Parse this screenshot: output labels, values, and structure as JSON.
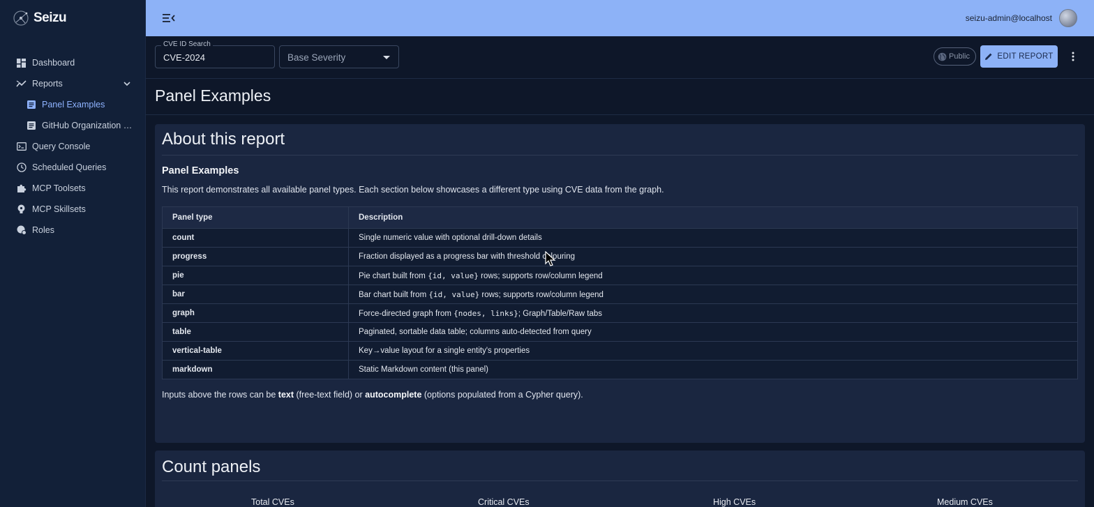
{
  "app": {
    "name": "Seizu"
  },
  "sidebar": {
    "items": [
      {
        "label": "Dashboard",
        "icon": "dashboard-icon"
      },
      {
        "label": "Reports",
        "icon": "reports-chart-icon",
        "expanded": true
      },
      {
        "label": "Panel Examples",
        "icon": "document-icon",
        "active": true
      },
      {
        "label": "GitHub Organization S...",
        "icon": "document-icon"
      },
      {
        "label": "Query Console",
        "icon": "terminal-icon"
      },
      {
        "label": "Scheduled Queries",
        "icon": "clock-icon"
      },
      {
        "label": "MCP Toolsets",
        "icon": "puzzle-icon"
      },
      {
        "label": "MCP Skillsets",
        "icon": "lightbulb-icon"
      },
      {
        "label": "Roles",
        "icon": "roles-icon"
      }
    ]
  },
  "topbar": {
    "user_email": "seizu-admin@localhost"
  },
  "filters": {
    "cve_search": {
      "legend": "CVE ID Search",
      "value": "CVE-2024"
    },
    "severity": {
      "placeholder": "Base Severity"
    }
  },
  "actions": {
    "public_label": "Public",
    "edit_label": "EDIT REPORT"
  },
  "page": {
    "title": "Panel Examples"
  },
  "about": {
    "heading": "About this report",
    "subheading": "Panel Examples",
    "description": "This report demonstrates all available panel types. Each section below showcases a different type using CVE data from the graph.",
    "table": {
      "headers": [
        "Panel type",
        "Description"
      ],
      "rows": [
        {
          "type": "count",
          "desc": "Single numeric value with optional drill-down details"
        },
        {
          "type": "progress",
          "desc": "Fraction displayed as a progress bar with threshold colouring"
        },
        {
          "type": "pie",
          "desc_pre": "Pie chart built from ",
          "desc_code": "{id, value}",
          "desc_post": " rows; supports row/column legend"
        },
        {
          "type": "bar",
          "desc_pre": "Bar chart built from ",
          "desc_code": "{id, value}",
          "desc_post": " rows; supports row/column legend"
        },
        {
          "type": "graph",
          "desc_pre": "Force-directed graph from ",
          "desc_code": "{nodes, links}",
          "desc_post": "; Graph/Table/Raw tabs"
        },
        {
          "type": "table",
          "desc": "Paginated, sortable data table; columns auto-detected from query"
        },
        {
          "type": "vertical-table",
          "desc": "Key→value layout for a single entity's properties"
        },
        {
          "type": "markdown",
          "desc": "Static Markdown content (this panel)"
        }
      ]
    },
    "footer": {
      "pre": "Inputs above the rows can be ",
      "b1": "text",
      "mid": " (free-text field) or ",
      "b2": "autocomplete",
      "post": " (options populated from a Cypher query)."
    }
  },
  "count_panels": {
    "heading": "Count panels",
    "labels": [
      "Total CVEs",
      "Critical CVEs",
      "High CVEs",
      "Medium CVEs"
    ]
  }
}
